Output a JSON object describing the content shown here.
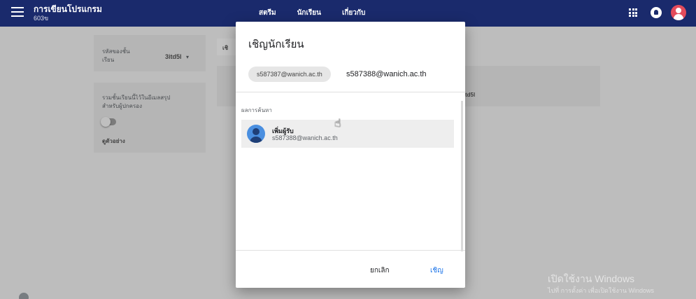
{
  "topbar": {
    "app_title": "การเขียนโปรแกรม",
    "app_subtitle": "603ข",
    "tabs": [
      "สตรีม",
      "นักเรียน",
      "เกี่ยวกับ"
    ]
  },
  "background": {
    "class_code_label": "รหัสของชั้นเรียน",
    "class_code_value": "3itd5l",
    "invite_tab_partial": "เชิ",
    "summary_label": "รวมชั้นเรียนนี้ไว้ในอีเมลสรุปสำหรับผู้ปกครอง",
    "preview_link": "ดูตัวอย่าง",
    "right_code_partial": "td5l"
  },
  "dialog": {
    "title": "เชิญนักเรียน",
    "chip_email": "s587387@wanich.ac.th",
    "input_value": "s587388@wanich.ac.th",
    "results_label": "ผลการค้นหา",
    "result_name": "เพิ่มผู้รับ",
    "result_email": "s587388@wanich.ac.th",
    "cancel_label": "ยกเลิก",
    "invite_label": "เชิญ"
  },
  "watermark": {
    "line1": "เปิดใช้งาน Windows",
    "line2": "ไปที่ การตั้งค่า เพื่อเปิดใช้งาน Windows"
  },
  "colors": {
    "topbar": "#1a2a6c",
    "accent": "#1a73e8",
    "avatar": "#e34b5b"
  }
}
